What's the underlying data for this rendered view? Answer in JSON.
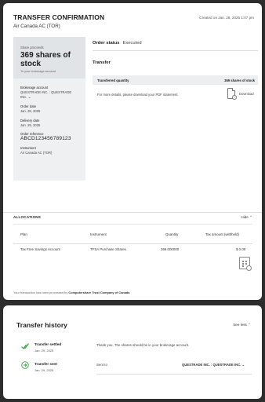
{
  "header": {
    "title": "TRANSFER CONFIRMATION",
    "subtitle": "Air Canada AC (TOR)",
    "created": "Created on Jan. 28, 2025 1:07 pm"
  },
  "summary": {
    "proceeds_label": "Share proceeds",
    "proceeds_value": "369 shares of stock",
    "proceeds_hint": "To your brokerage account",
    "fields": [
      {
        "label": "Brokerage account",
        "value": "QUESTRADE INC. : QUESTRADE INC."
      },
      {
        "label": "Order date",
        "value": "Jan. 28, 2025"
      },
      {
        "label": "Delivery date",
        "value": "Jan. 29, 2025"
      },
      {
        "label": "Order reference",
        "value": "ABCD123456789123"
      },
      {
        "label": "Instrument",
        "value": "Air Canada AC (TOR)"
      }
    ]
  },
  "order_status": {
    "label": "Order status",
    "value": "Executed"
  },
  "transfer": {
    "heading": "Transfer",
    "qty_label": "Transferred quantity",
    "qty_value": "369 shares of stock",
    "pdf_text": "For more details, please download your PDF statement.",
    "download_label": "Download"
  },
  "allocations": {
    "heading": "ALLOCATIONS",
    "toggle": "Hide",
    "columns": [
      "Plan",
      "Instrument",
      "Quantity",
      "Tax amount (withheld)"
    ],
    "rows": [
      [
        "Tax Free Savings Account",
        "TFSA Purchase Shares",
        "369.000000",
        "$ 0.00"
      ]
    ]
  },
  "processed": {
    "text": "Your transaction has been processed by",
    "company": "Computershare Trust Company of Canada"
  },
  "history": {
    "title": "Transfer history",
    "toggle": "See less",
    "events": [
      {
        "title": "Transfer settled",
        "date": "Jan. 29, 2025",
        "message": "Thank you. The shares should be in your brokerage account."
      },
      {
        "title": "Transfer sent",
        "date": "Jan. 29, 2025",
        "message": "Sent to",
        "account": "QUESTRADE INC. : QUESTRADE INC."
      }
    ]
  },
  "colors": {
    "accent_green": "#2e9e3e",
    "background": "#2d2d2d"
  }
}
